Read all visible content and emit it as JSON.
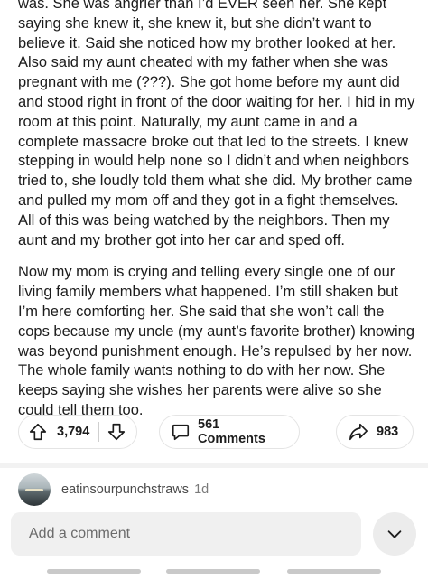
{
  "post": {
    "cutoff_line": "was. She was angrier than I'd EVER seen her. She kept",
    "paragraphs": [
      "was. She was angrier than I’d EVER seen her. She kept saying she knew it, she knew it, but she didn’t want to believe it. Said she noticed how my brother looked at her. Also said my aunt cheated with my father when she was pregnant with me (???). She got home before my aunt did and stood right in front of the door waiting for her. I hid in my room at this point. Naturally, my aunt came in and a complete massacre broke out that led to the streets. I knew stepping in would help none so I didn’t and when neighbors tried to, she loudly told them what she did. My brother came and pulled my mom off and they got in a fight themselves. All of this was being watched by the neighbors. Then my aunt and my brother got into her car and sped off.",
      "Now my mom is crying and telling every single one of our living family members what happened. I’m still shaken but I’m here comforting her. She said that she won’t call the cops because my uncle (my aunt’s favorite brother) knowing was beyond punishment enough. He’s repulsed by her now. The whole family wants nothing to do with her now. She keeps saying she wishes her parents were alive so she could tell them too."
    ]
  },
  "actions": {
    "upvote_icon": "upvote-arrow-icon",
    "vote_count": "3,794",
    "downvote_icon": "downvote-arrow-icon",
    "comment_icon": "comment-bubble-icon",
    "comments_label": "561 Comments",
    "share_icon": "share-arrow-icon",
    "share_count": "983"
  },
  "comment": {
    "username": "eatinsourpunchstraws",
    "age": "1d"
  },
  "composer": {
    "placeholder": "Add a comment",
    "expand_icon": "chevron-down-icon"
  },
  "colors": {
    "text": "#1c1c1c",
    "border": "#e4e4e4",
    "input_bg": "#f0f0f0"
  }
}
